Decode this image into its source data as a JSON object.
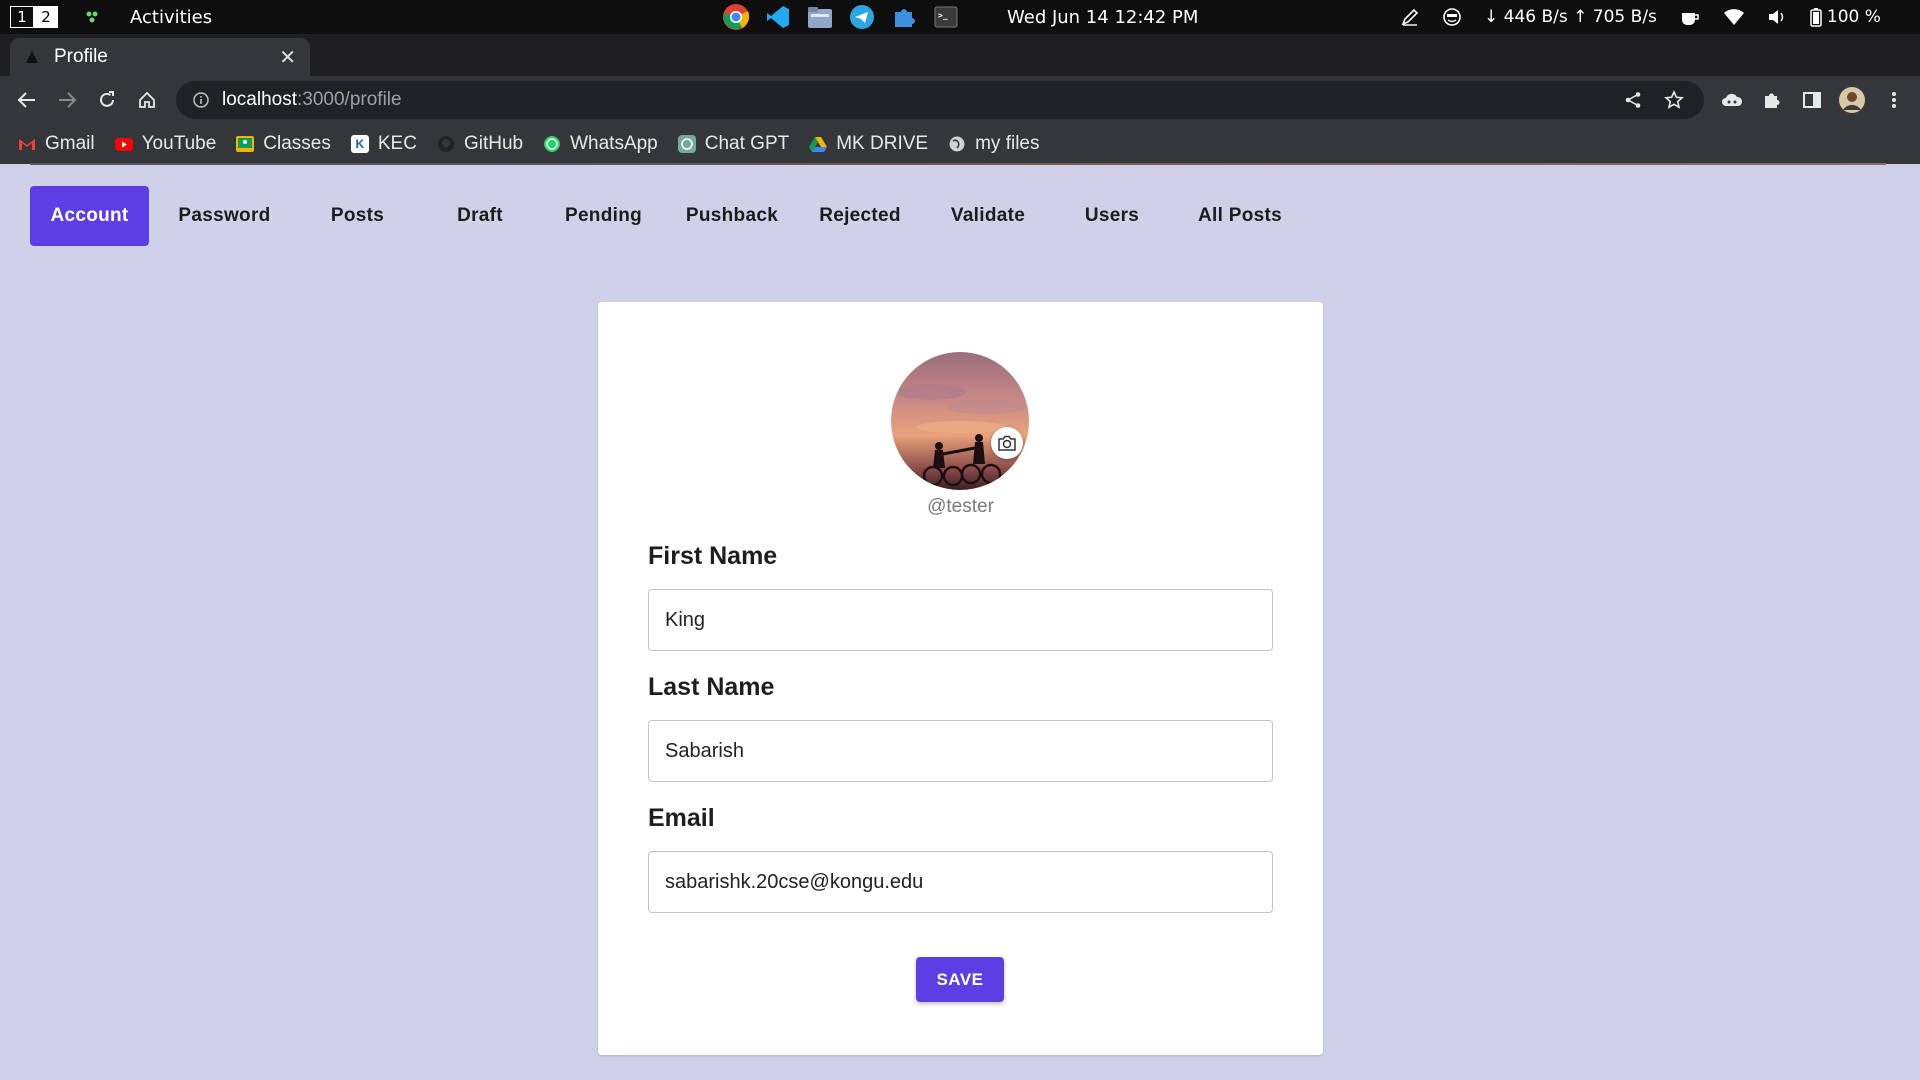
{
  "system": {
    "workspace_1": "1",
    "workspace_2": "2",
    "activities": "Activities",
    "clock": "Wed Jun 14  12:42 PM",
    "network_speed": "↓ 446 B/s ↑ 705 B/s",
    "battery": "100 %"
  },
  "browser": {
    "tab_title": "Profile",
    "close_glyph": "✕",
    "new_tab_glyph": "+",
    "url_host": "localhost",
    "url_path": ":3000/profile",
    "bookmarks": [
      "Gmail",
      "YouTube",
      "Classes",
      "KEC",
      "GitHub",
      "WhatsApp",
      "Chat GPT",
      "MK DRIVE",
      "my files"
    ]
  },
  "nav": {
    "tabs": [
      "Account",
      "Password",
      "Posts",
      "Draft",
      "Pending",
      "Pushback",
      "Rejected",
      "Validate",
      "Users",
      "All Posts"
    ],
    "active_index": 0
  },
  "profile": {
    "handle": "@tester",
    "first_name_label": "First Name",
    "first_name_value": "King",
    "last_name_label": "Last Name",
    "last_name_value": "Sabarish",
    "email_label": "Email",
    "email_value": "sabarishk.20cse@kongu.edu",
    "save_label": "SAVE"
  },
  "colors": {
    "accent": "#5b3fe4",
    "page_bg": "#d1d0e9"
  }
}
